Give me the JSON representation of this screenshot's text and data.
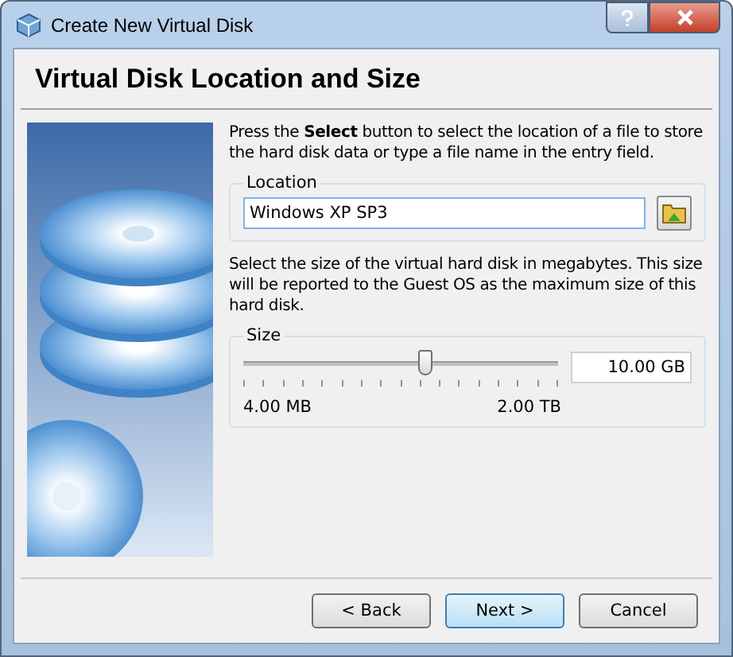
{
  "window": {
    "title": "Create New Virtual Disk"
  },
  "page": {
    "heading": "Virtual Disk Location and Size"
  },
  "location_intro": "Press the **Select** button to select the location of a file to store the hard disk data or type a file name in the entry field.",
  "location": {
    "label": "Location",
    "value": "Windows XP SP3"
  },
  "size_intro": "Select the size of the virtual hard disk in megabytes. This size will be reported to the Guest OS as the maximum size of this hard disk.",
  "size": {
    "label": "Size",
    "level": 0.58,
    "value": "10.00 GB",
    "min_label": "4.00 MB",
    "max_label": "2.00 TB"
  },
  "buttons": [
    {
      "label": "< Back",
      "default": false
    },
    {
      "label": "Next >",
      "default": true
    },
    {
      "label": "Cancel",
      "default": false
    }
  ]
}
